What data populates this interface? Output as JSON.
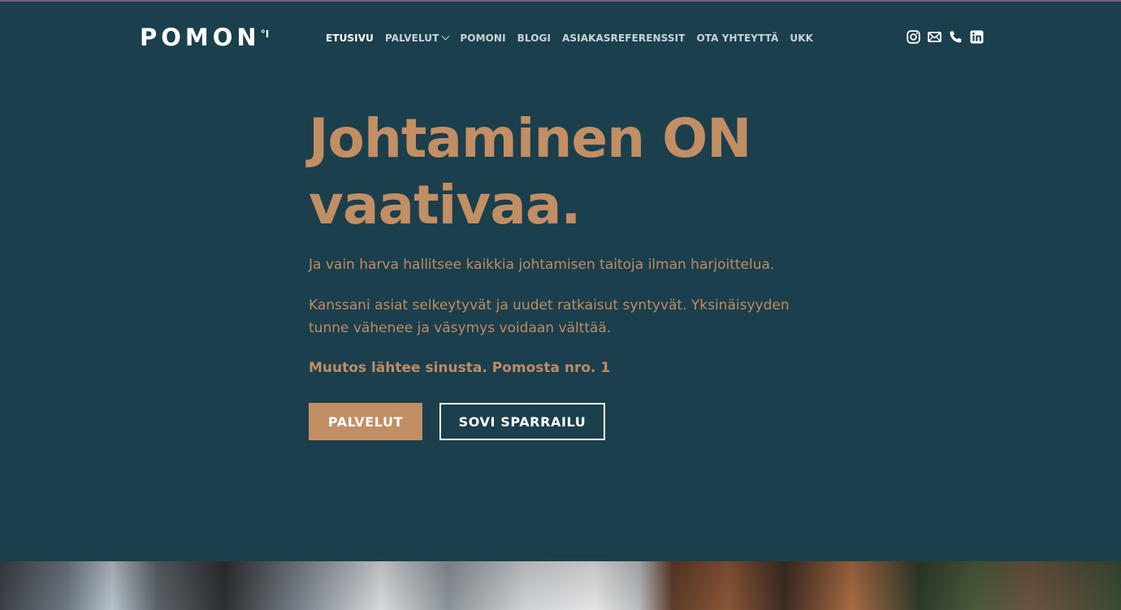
{
  "brand": {
    "logo_text": "POMON",
    "logo_sup": "°I"
  },
  "nav": {
    "items": [
      {
        "label": "ETUSIVU",
        "active": true
      },
      {
        "label": "PALVELUT",
        "has_dropdown": true
      },
      {
        "label": "POMONI"
      },
      {
        "label": "BLOGI"
      },
      {
        "label": "ASIAKASREFERENSSIT"
      },
      {
        "label": "OTA YHTEYTTÄ"
      },
      {
        "label": "UKK"
      }
    ]
  },
  "social": {
    "icons": [
      "instagram-icon",
      "mail-icon",
      "phone-icon",
      "linkedin-icon"
    ]
  },
  "hero": {
    "title_line1": "Johtaminen ON",
    "title_line2": "vaativaa.",
    "paragraph1": "Ja vain harva hallitsee kaikkia johtamisen taitoja ilman harjoittelua.",
    "paragraph2": "Kanssani asiat selkeytyvät ja uudet ratkaisut syntyvät. Yksinäisyyden tunne vähenee ja väsymys voidaan välttää.",
    "paragraph3": "Muutos lähtee sinusta. Pomosta nro. 1",
    "primary_button": "PALVELUT",
    "secondary_button": "SOVI SPARRAILU"
  },
  "colors": {
    "background": "#1b3f4c",
    "accent": "#c28e64",
    "text_light": "#ffffff"
  }
}
